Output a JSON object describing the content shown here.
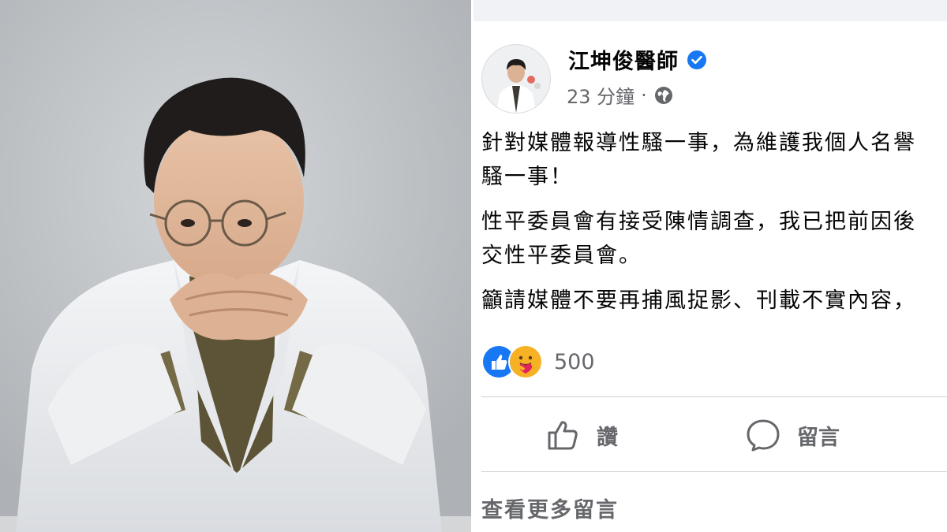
{
  "photo": {
    "subject": "doctor-portrait"
  },
  "post": {
    "author": "江坤俊醫師",
    "verified_icon": "verified-badge-icon",
    "time": "23 分鐘",
    "separator": "·",
    "audience_icon": "globe-icon",
    "paragraphs": [
      "針對媒體報導性騷一事，為維護我個人名譽",
      "騷一事！",
      "性平委員會有接受陳情調查，我已把前因後",
      "交性平委員會。",
      "籲請媒體不要再捕風捉影、刊載不實內容，"
    ],
    "reactions": {
      "icons": [
        "like-reaction-icon",
        "care-reaction-icon"
      ],
      "count": "500"
    },
    "actions": {
      "like_label": "讚",
      "comment_label": "留言"
    },
    "more_comments": "查看更多留言"
  },
  "colors": {
    "facebook_blue": "#1877f2",
    "text_primary": "#050505",
    "text_secondary": "#65676b",
    "divider": "#ced0d4"
  }
}
